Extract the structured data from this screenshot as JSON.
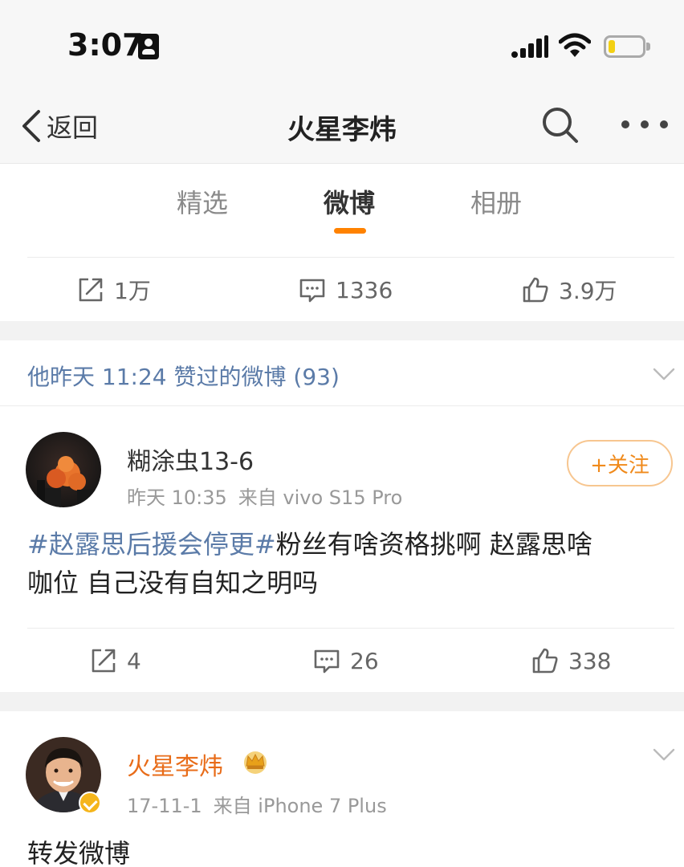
{
  "status_bar": {
    "time": "3:07",
    "icons": [
      "id-card-icon",
      "signal-icon",
      "wifi-icon",
      "battery-icon"
    ],
    "battery_color": "#f3d013"
  },
  "nav": {
    "back_label": "返回",
    "title": "火星李炜",
    "icons": [
      "chevron-left-icon",
      "search-icon",
      "more-icon"
    ]
  },
  "tabs": [
    {
      "label": "精选",
      "active": false
    },
    {
      "label": "微博",
      "active": true
    },
    {
      "label": "相册",
      "active": false
    }
  ],
  "accent_color": "#ff8200",
  "link_color": "#5b7ba8",
  "top_actions": {
    "repost": "1万",
    "comment": "1336",
    "like": "3.9万"
  },
  "liked_header": {
    "text": "他昨天 11:24 赞过的微博 (93)"
  },
  "post1": {
    "username": "糊涂虫13-6",
    "time": "昨天 10:35",
    "source": "来自 vivo S15 Pro",
    "follow_label": "+关注",
    "hashtag": "#赵露思后援会停更#",
    "text_line1": "粉丝有啥资格挑啊  赵露思啥",
    "text_line2": "咖位  自己没有自知之明吗",
    "repost": "4",
    "comment": "26",
    "like": "338"
  },
  "post2": {
    "username": "火星李炜",
    "time": "17-11-1",
    "source": "来自 iPhone 7 Plus",
    "text": "转发微博",
    "verified_badge_color": "#f5b51b"
  }
}
